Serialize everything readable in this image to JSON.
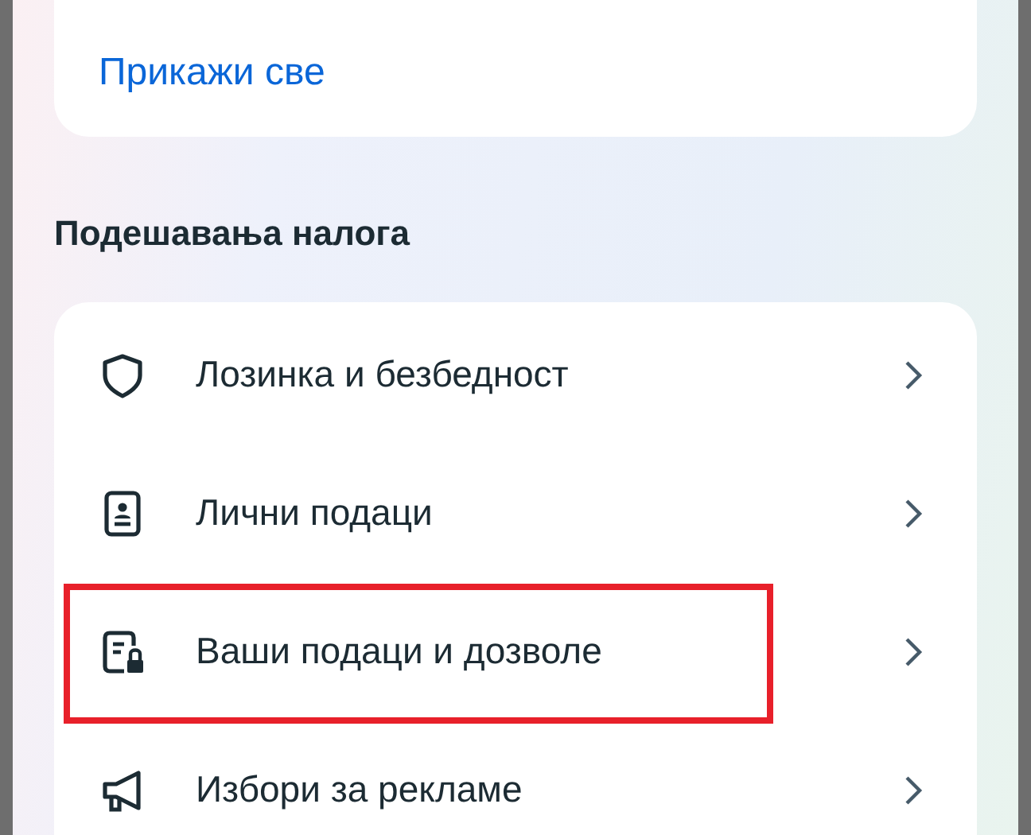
{
  "top_card": {
    "link": "Прикажи све"
  },
  "section": {
    "title": "Подешавања налога"
  },
  "items": [
    {
      "label": "Лозинка и безбедност",
      "highlighted": false
    },
    {
      "label": "Лични подаци",
      "highlighted": false
    },
    {
      "label": "Ваши подаци и дозволе",
      "highlighted": true
    },
    {
      "label": "Избори за рекламе",
      "highlighted": false
    }
  ]
}
